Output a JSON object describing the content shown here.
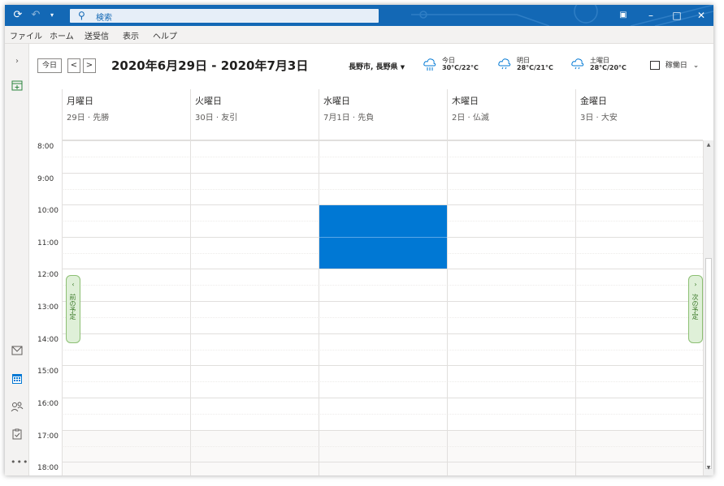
{
  "titlebar": {
    "search_placeholder": "検索",
    "minimize": "–",
    "maximize": "□",
    "close": "✕"
  },
  "menu": [
    "ファイル",
    "ホーム",
    "送受信",
    "表示",
    "ヘルプ"
  ],
  "header": {
    "today_label": "今日",
    "prev": "<",
    "next": ">",
    "date_range": "2020年6月29日 - 2020年7月3日",
    "location": "長野市, 長野県",
    "weather": [
      {
        "day": "今日",
        "temp": "30°C/22°C"
      },
      {
        "day": "明日",
        "temp": "28°C/21°C"
      },
      {
        "day": "土曜日",
        "temp": "28°C/20°C"
      }
    ],
    "view_label": "稼働日"
  },
  "days": [
    {
      "name": "月曜日",
      "date": "29日 · 先勝"
    },
    {
      "name": "火曜日",
      "date": "30日 · 友引"
    },
    {
      "name": "水曜日",
      "date": "7月1日 · 先負"
    },
    {
      "name": "木曜日",
      "date": "2日 · 仏滅"
    },
    {
      "name": "金曜日",
      "date": "3日 · 大安"
    }
  ],
  "times": [
    "8:00",
    "9:00",
    "10:00",
    "11:00",
    "12:00",
    "13:00",
    "14:00",
    "15:00",
    "16:00",
    "17:00",
    "18:00"
  ],
  "peek": {
    "prev_label": "前の予定",
    "next_label": "次の予定"
  },
  "colors": {
    "titlebar": "#1368b5",
    "event": "#0078d4",
    "peek_bg": "#dff0d8"
  }
}
